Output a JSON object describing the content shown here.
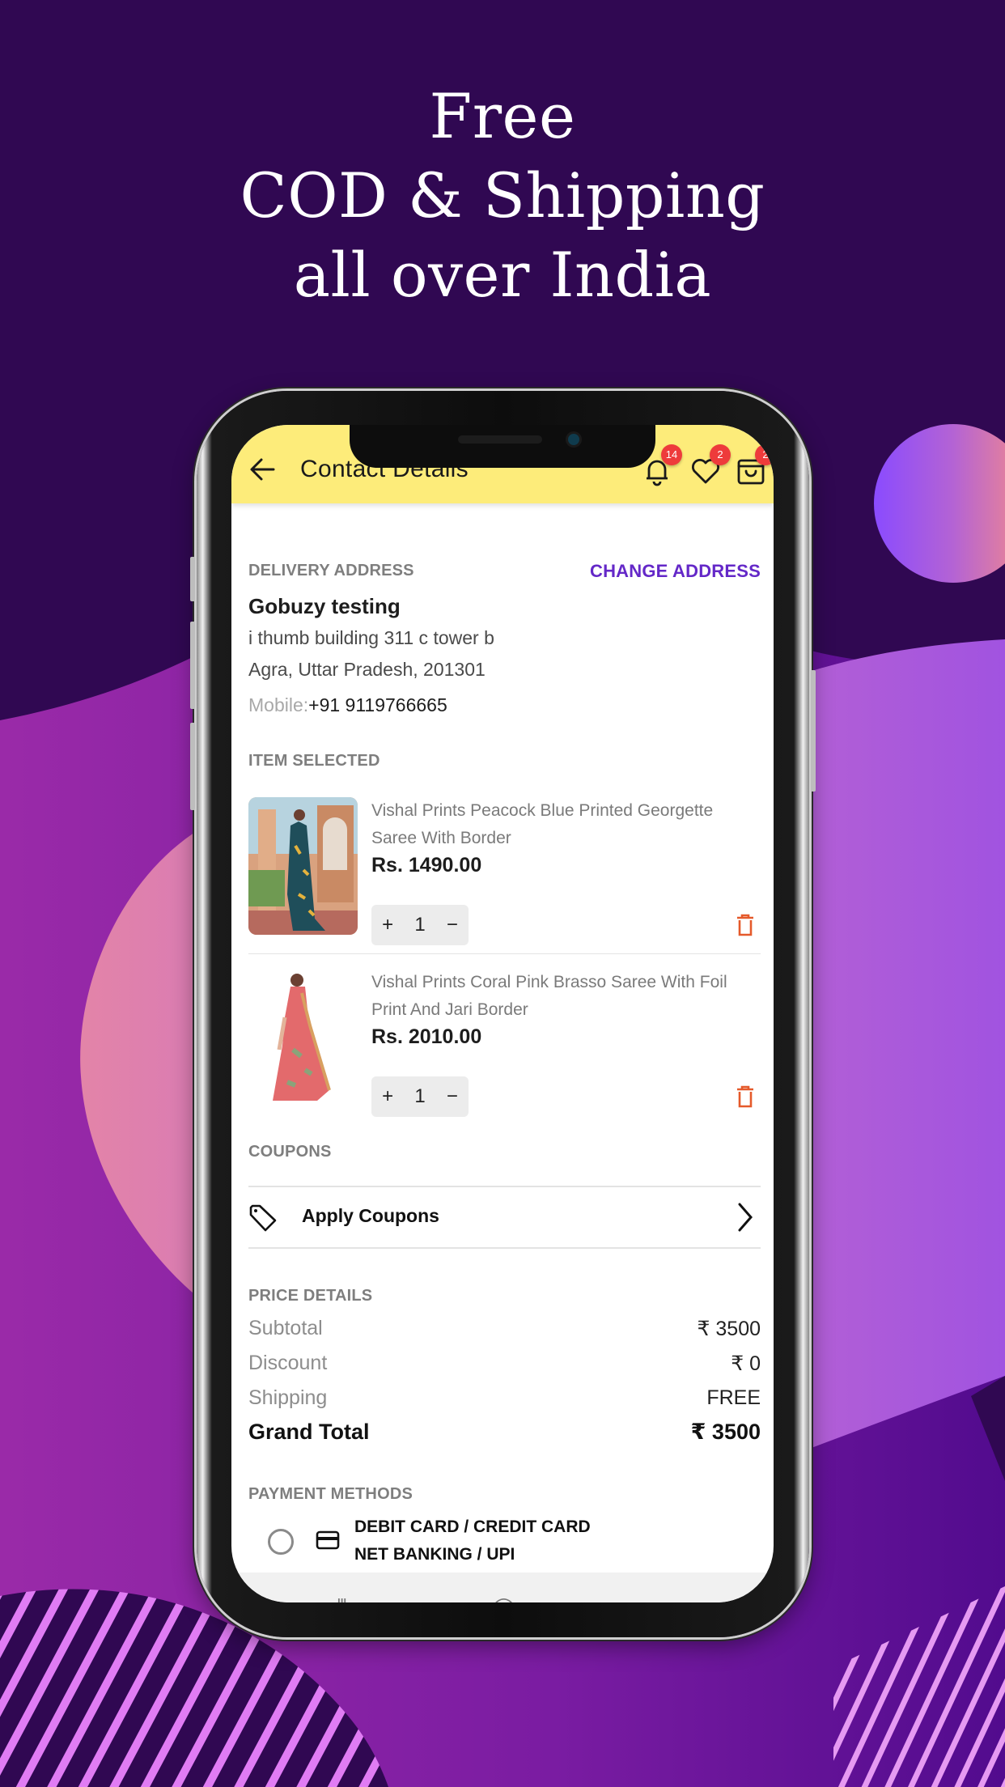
{
  "promo": {
    "headline_lines": [
      "Free",
      "COD & Shipping",
      "all over India"
    ]
  },
  "colors": {
    "background_dark": "#300852",
    "header_yellow": "#fdec7a",
    "accent_purple": "#6428c8",
    "badge_red": "#ee3b3b",
    "trash_orange": "#e55a2b"
  },
  "header": {
    "title": "Contact Details",
    "back_icon": "arrow-left-icon",
    "icons": [
      {
        "name": "bell-icon",
        "badge": "14"
      },
      {
        "name": "heart-icon",
        "badge": "2"
      },
      {
        "name": "shopping-bag-icon",
        "badge": "2"
      }
    ]
  },
  "delivery": {
    "section_label": "DELIVERY ADDRESS",
    "change_label": "CHANGE ADDRESS",
    "name": "Gobuzy testing",
    "address_line1": "i thumb building 311 c tower b",
    "address_line2": "Agra, Uttar Pradesh, 201301",
    "mobile_label": "Mobile:",
    "mobile_value": "+91 9119766665"
  },
  "items": {
    "section_label": "ITEM SELECTED",
    "list": [
      {
        "title": "Vishal Prints Peacock Blue Printed Georgette Saree With Border",
        "price": "Rs. 1490.00",
        "qty_plus": "+",
        "qty": "1",
        "qty_minus": "−"
      },
      {
        "title": "Vishal Prints Coral Pink Brasso Saree With Foil Print And Jari Border",
        "price": "Rs. 2010.00",
        "qty_plus": "+",
        "qty": "1",
        "qty_minus": "−"
      }
    ]
  },
  "coupons": {
    "section_label": "COUPONS",
    "apply_label": "Apply Coupons"
  },
  "price_details": {
    "section_label": "PRICE DETAILS",
    "rows": [
      {
        "label": "Subtotal",
        "value": "₹ 3500"
      },
      {
        "label": "Discount",
        "value": "₹ 0"
      },
      {
        "label": "Shipping",
        "value": "FREE"
      }
    ],
    "grand_total_label": "Grand Total",
    "grand_total_value": "₹ 3500"
  },
  "payment": {
    "section_label": "PAYMENT METHODS",
    "options": [
      {
        "line1": "DEBIT CARD / CREDIT CARD",
        "line2": "NET BANKING / UPI",
        "selected": false
      }
    ]
  },
  "system_nav": {
    "recent": "|||",
    "home": "◯",
    "back": "‹"
  }
}
